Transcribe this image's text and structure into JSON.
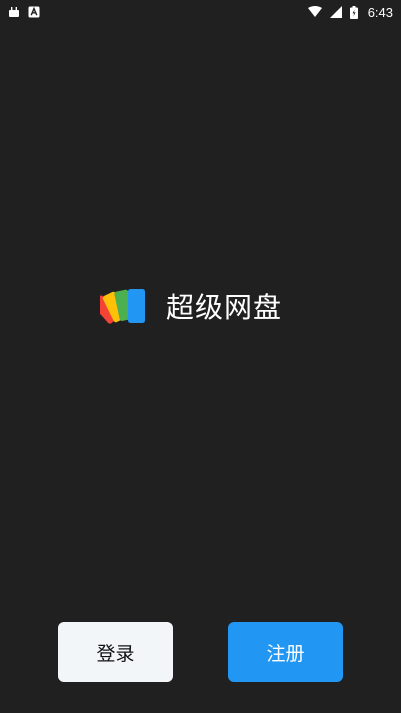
{
  "status_bar": {
    "time": "6:43",
    "icons_left": [
      "android-notification-icon",
      "text-notification-icon"
    ],
    "icons_right": [
      "wifi-icon",
      "cell-signal-icon",
      "battery-icon"
    ]
  },
  "brand": {
    "logo": "stacked-cards-logo",
    "title": "超级网盘",
    "logo_colors": [
      "#f44336",
      "#ffc107",
      "#4caf50",
      "#2196f3"
    ]
  },
  "actions": {
    "login_label": "登录",
    "register_label": "注册"
  },
  "colors": {
    "background": "#202020",
    "login_bg": "#f3f6f9",
    "register_bg": "#2196f3"
  }
}
